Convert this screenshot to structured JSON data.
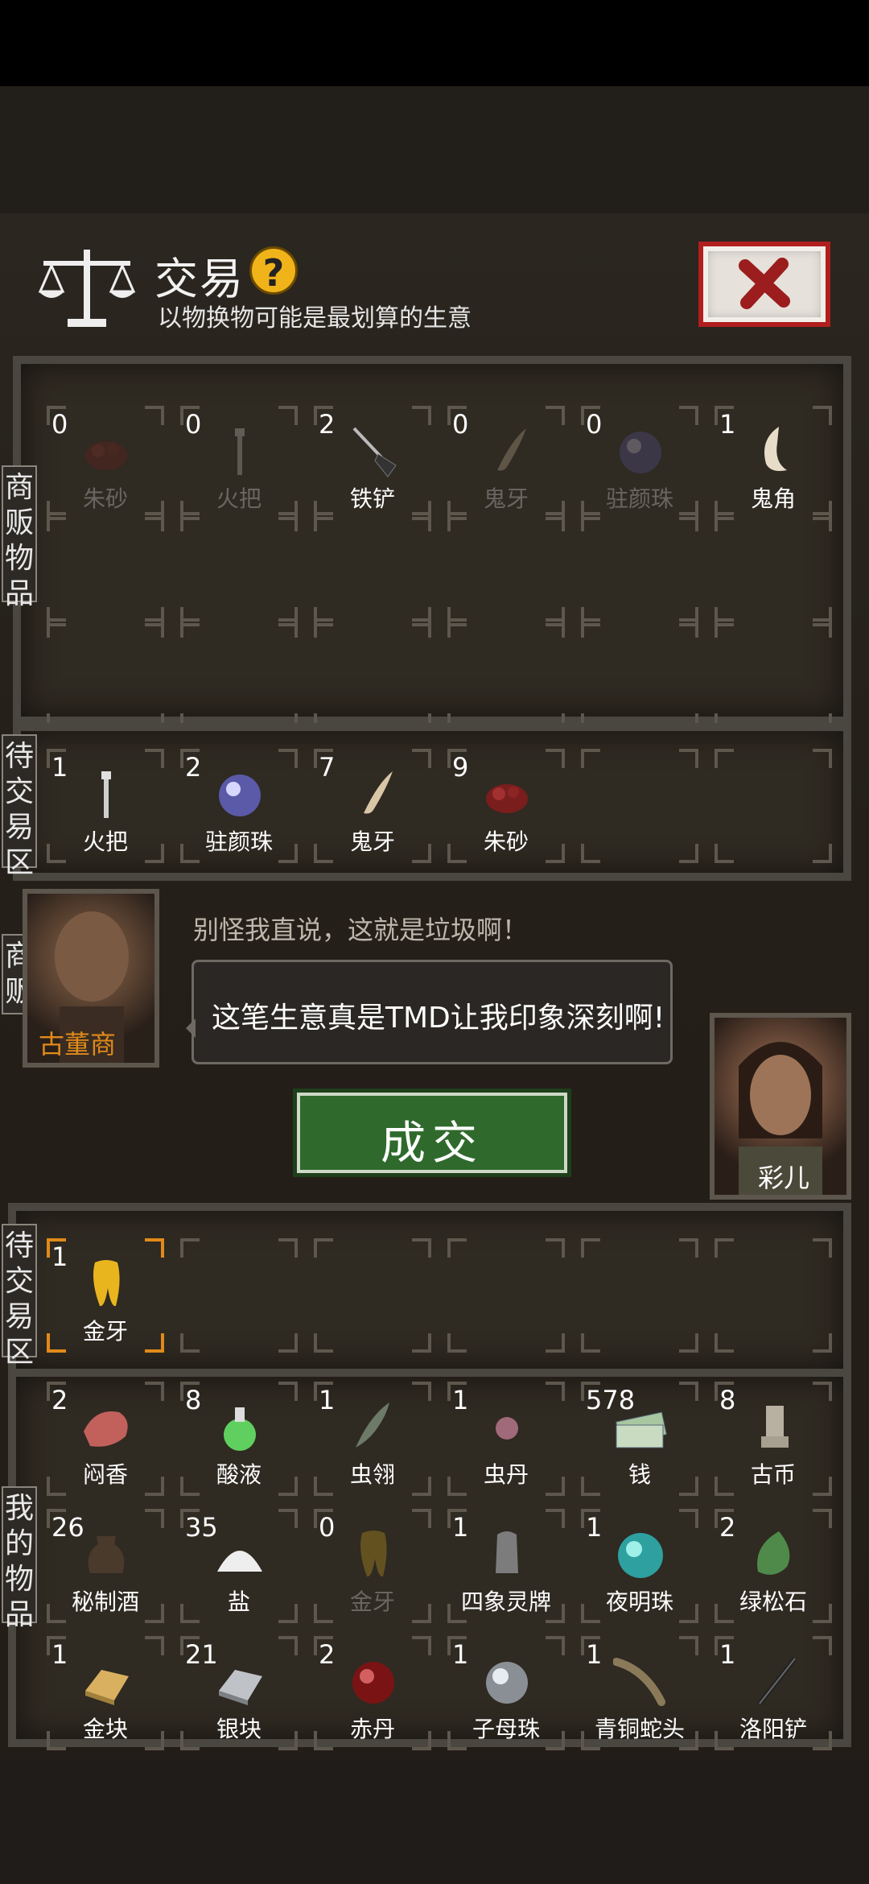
{
  "header": {
    "title": "交易",
    "help_icon": "?",
    "subtitle": "以物换物可能是最划算的生意"
  },
  "labels": {
    "merchant_goods": "商贩物品",
    "merchant_pending": "待交易区",
    "merchant": "商贩",
    "my_pending": "待交易区",
    "my_goods": "我的物品"
  },
  "merchant_goods": [
    {
      "count": "0",
      "name": "朱砂",
      "icon": "cinnabar-icon",
      "dim": true
    },
    {
      "count": "0",
      "name": "火把",
      "icon": "torch-icon",
      "dim": true
    },
    {
      "count": "2",
      "name": "铁铲",
      "icon": "shovel-icon",
      "dim": false
    },
    {
      "count": "0",
      "name": "鬼牙",
      "icon": "ghost-tooth-icon",
      "dim": true
    },
    {
      "count": "0",
      "name": "驻颜珠",
      "icon": "pearl-icon",
      "dim": true
    },
    {
      "count": "1",
      "name": "鬼角",
      "icon": "ghost-horn-icon",
      "dim": false
    }
  ],
  "merchant_pending": [
    {
      "count": "1",
      "name": "火把",
      "icon": "torch-icon"
    },
    {
      "count": "2",
      "name": "驻颜珠",
      "icon": "pearl-icon"
    },
    {
      "count": "7",
      "name": "鬼牙",
      "icon": "ghost-tooth-icon"
    },
    {
      "count": "9",
      "name": "朱砂",
      "icon": "cinnabar-icon"
    }
  ],
  "dialog": {
    "merchant_name": "古董商",
    "line1": "别怪我直说，这就是垃圾啊！",
    "line2": "这笔生意真是TMD让我印象深刻啊!",
    "deal_button": "成交",
    "player_name": "彩儿"
  },
  "my_pending": [
    {
      "count": "1",
      "name": "金牙",
      "icon": "gold-tooth-icon"
    }
  ],
  "my_goods": [
    {
      "count": "2",
      "name": "闷香",
      "icon": "meat-icon"
    },
    {
      "count": "8",
      "name": "酸液",
      "icon": "acid-flask-icon"
    },
    {
      "count": "1",
      "name": "虫翎",
      "icon": "feather-icon"
    },
    {
      "count": "1",
      "name": "虫丹",
      "icon": "bead-icon"
    },
    {
      "count": "578",
      "name": "钱",
      "icon": "money-icon"
    },
    {
      "count": "8",
      "name": "古币",
      "icon": "ancient-coin-icon"
    },
    {
      "count": "26",
      "name": "秘制酒",
      "icon": "wine-jar-icon"
    },
    {
      "count": "35",
      "name": "盐",
      "icon": "salt-icon"
    },
    {
      "count": "0",
      "name": "金牙",
      "icon": "gold-tooth-icon",
      "dim": true
    },
    {
      "count": "1",
      "name": "四象灵牌",
      "icon": "tablet-icon"
    },
    {
      "count": "1",
      "name": "夜明珠",
      "icon": "glow-pearl-icon"
    },
    {
      "count": "2",
      "name": "绿松石",
      "icon": "turquoise-icon"
    },
    {
      "count": "1",
      "name": "金块",
      "icon": "gold-bar-icon"
    },
    {
      "count": "21",
      "name": "银块",
      "icon": "silver-bar-icon"
    },
    {
      "count": "2",
      "name": "赤丹",
      "icon": "red-pill-icon"
    },
    {
      "count": "1",
      "name": "子母珠",
      "icon": "orb-icon"
    },
    {
      "count": "1",
      "name": "青铜蛇头",
      "icon": "bronze-snake-icon"
    },
    {
      "count": "1",
      "name": "洛阳铲",
      "icon": "luoyang-shovel-icon"
    }
  ],
  "colors": {
    "accent": "#f0b41a",
    "deal_green": "#2f6a2c",
    "close_red": "#b11e1e",
    "merchant_name": "#e08a1a",
    "selected": "#e08a1a"
  }
}
